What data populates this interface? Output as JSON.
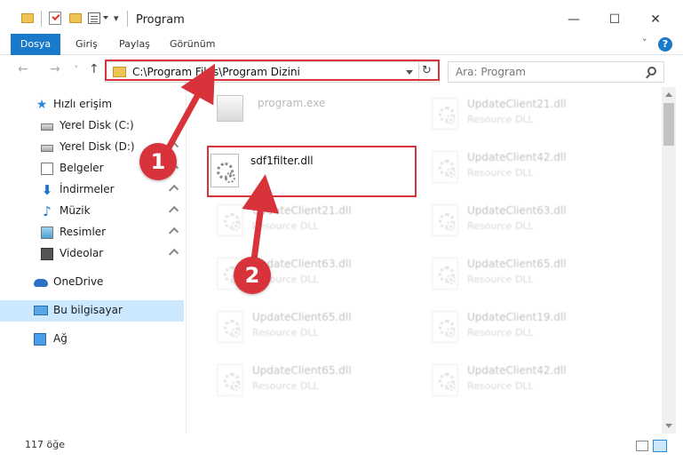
{
  "window": {
    "title": "Program",
    "minimize_glyph": "—",
    "maximize_glyph": "☐",
    "close_glyph": "✕",
    "qa_more_glyph": "▾"
  },
  "ribbon": {
    "tabs": [
      "Dosya",
      "Giriş",
      "Paylaş",
      "Görünüm"
    ],
    "collapse_glyph": "˅",
    "help_glyph": "?"
  },
  "navigation": {
    "back_glyph": "←",
    "forward_glyph": "→",
    "recent_glyph": "˅",
    "up_glyph": "↑",
    "address": "C:\\Program Files\\Program Dizini",
    "refresh_glyph": "↻",
    "search_placeholder": "Ara: Program"
  },
  "sidebar": {
    "items": [
      {
        "label": "Hızlı erişim",
        "icon": "quick-access-star-icon",
        "glyph": "★"
      },
      {
        "label": "Yerel Disk (C:)",
        "icon": "local-disk-icon"
      },
      {
        "label": "Yerel Disk (D:)",
        "icon": "local-disk-icon"
      },
      {
        "label": "Belgeler",
        "icon": "documents-icon"
      },
      {
        "label": "İndirmeler",
        "icon": "downloads-icon",
        "glyph": "⬇"
      },
      {
        "label": "Müzik",
        "icon": "music-icon",
        "glyph": "♪"
      },
      {
        "label": "Resimler",
        "icon": "pictures-icon"
      },
      {
        "label": "Videolar",
        "icon": "videos-icon"
      },
      {
        "label": "OneDrive",
        "icon": "onedrive-cloud-icon"
      },
      {
        "label": "Bu bilgisayar",
        "icon": "this-pc-icon"
      },
      {
        "label": "Ağ",
        "icon": "network-icon"
      }
    ]
  },
  "files": {
    "exe_name": "program.exe",
    "target_name": "sdf1filter.dll",
    "left_column": [
      {
        "name": "UpdateClient21.dll",
        "type": "Resource DLL"
      },
      {
        "name": "UpdateClient63.dll",
        "type": "Resource DLL"
      },
      {
        "name": "UpdateClient65.dll",
        "type": "Resource DLL"
      },
      {
        "name": "UpdateClient65.dll",
        "type": "Resource DLL"
      }
    ],
    "right_column": [
      {
        "name": "UpdateClient21.dll",
        "type": "Resource DLL"
      },
      {
        "name": "UpdateClient42.dll",
        "type": "Resource DLL"
      },
      {
        "name": "UpdateClient63.dll",
        "type": "Resource DLL"
      },
      {
        "name": "UpdateClient65.dll",
        "type": "Resource DLL"
      },
      {
        "name": "UpdateClient19.dll",
        "type": "Resource DLL"
      },
      {
        "name": "UpdateClient42.dll",
        "type": "Resource DLL"
      }
    ]
  },
  "callouts": {
    "step1": "1",
    "step2": "2"
  },
  "status": {
    "item_count": "117 öğe"
  },
  "colors": {
    "accent": "#1979ca",
    "highlight": "#d8333b",
    "selected": "#cce8ff"
  }
}
